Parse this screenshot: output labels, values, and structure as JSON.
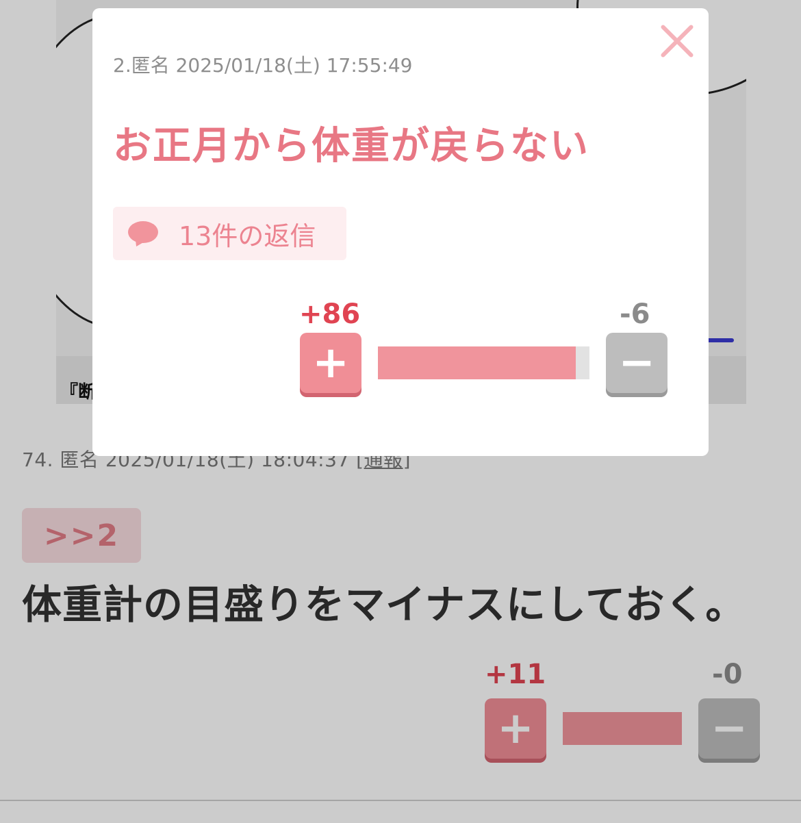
{
  "background_post": {
    "meta_prefix": "74. 匿名 2025/01/18(土) 18:04:37 [",
    "report_label": "通報",
    "meta_suffix": "]",
    "anchor": ">>2",
    "body": "体重計の目盛りをマイナスにしておく。",
    "manga_caption": "『断",
    "votes": {
      "plus": "+11",
      "minus": "-0",
      "plus_ratio": 1.0
    }
  },
  "modal": {
    "meta": "2.匿名 2025/01/18(土) 17:55:49",
    "title": "お正月から体重が戻らない",
    "reply_label": "13件の返信",
    "votes": {
      "plus": "+86",
      "minus": "-6",
      "plus_ratio": 0.935
    }
  },
  "icons": {
    "close": "close-icon",
    "reply": "speech-bubble-icon",
    "plus": "plus-icon",
    "minus": "minus-icon"
  },
  "colors": {
    "accent_pink": "#e87784",
    "plus_button": "#f08e96",
    "minus_button": "#bdbdbd",
    "plus_count": "#e04452"
  }
}
